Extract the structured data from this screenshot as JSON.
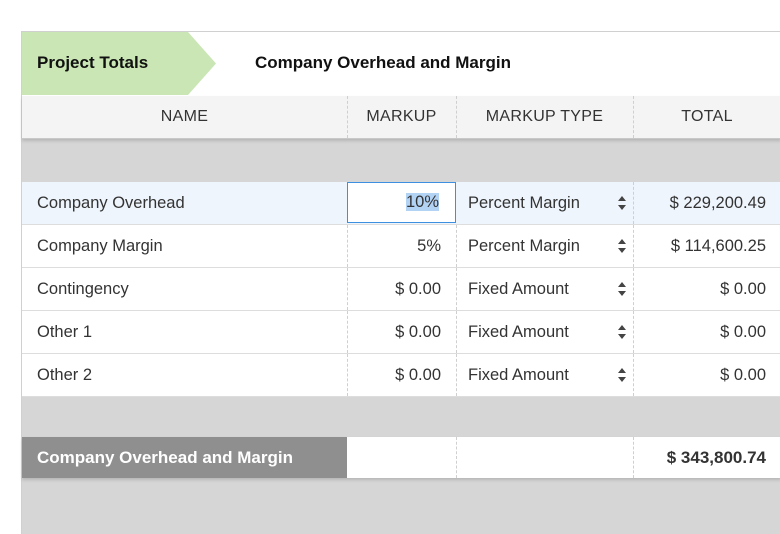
{
  "breadcrumb": {
    "active_label": "Project Totals",
    "current_label": "Company Overhead and Margin"
  },
  "table": {
    "columns": [
      "NAME",
      "MARKUP",
      "MARKUP TYPE",
      "TOTAL"
    ],
    "rows": [
      {
        "name": "Company Overhead",
        "markup": "10%",
        "markup_type": "Percent Margin",
        "total": "$ 229,200.49",
        "selected": true
      },
      {
        "name": "Company Margin",
        "markup": "5%",
        "markup_type": "Percent Margin",
        "total": "$ 114,600.25"
      },
      {
        "name": "Contingency",
        "markup": "$ 0.00",
        "markup_type": "Fixed Amount",
        "total": "$ 0.00"
      },
      {
        "name": "Other 1",
        "markup": "$ 0.00",
        "markup_type": "Fixed Amount",
        "total": "$ 0.00"
      },
      {
        "name": "Other 2",
        "markup": "$ 0.00",
        "markup_type": "Fixed Amount",
        "total": "$ 0.00"
      }
    ]
  },
  "footer": {
    "label": "Company Overhead and Margin",
    "total": "$ 343,800.74"
  },
  "colors": {
    "breadcrumb_active_bg": "#c9e6b4",
    "selection_border": "#3d8fe0",
    "selection_highlight": "#b3d3f5",
    "footer_label_bg": "#8f8f8f",
    "panel_bg": "#d6d6d6"
  }
}
